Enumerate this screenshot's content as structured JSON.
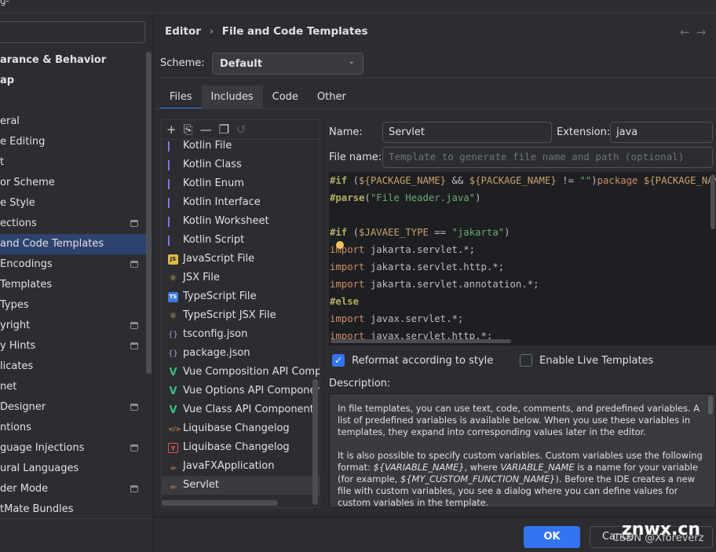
{
  "window": {
    "title_fragment": "g-"
  },
  "sidebar": {
    "items": [
      {
        "label": "arance & Behavior",
        "bold": true
      },
      {
        "label": "ap",
        "bold": true
      },
      {
        "label": ""
      },
      {
        "label": "eral"
      },
      {
        "label": "e Editing"
      },
      {
        "label": "t"
      },
      {
        "label": "or Scheme"
      },
      {
        "label": "e Style"
      },
      {
        "label": "ections",
        "icon": true
      },
      {
        "label": "and Code Templates",
        "selected": true
      },
      {
        "label": "Encodings",
        "icon": true
      },
      {
        "label": " Templates"
      },
      {
        "label": "Types"
      },
      {
        "label": "yright",
        "icon": true
      },
      {
        "label": "y Hints",
        "icon": true
      },
      {
        "label": "licates"
      },
      {
        "label": "net"
      },
      {
        "label": " Designer",
        "icon": true
      },
      {
        "label": "ntions"
      },
      {
        "label": "guage Injections",
        "icon": true
      },
      {
        "label": "ural Languages"
      },
      {
        "label": "der Mode",
        "icon": true
      },
      {
        "label": "tMate Bundles"
      }
    ]
  },
  "header": {
    "breadcrumb": [
      "Editor",
      "File and Code Templates"
    ],
    "separator": "›",
    "back": "←",
    "forward": "→"
  },
  "scheme": {
    "label": "Scheme:",
    "value": "Default"
  },
  "tabs": [
    {
      "label": "Files",
      "selected": true
    },
    {
      "label": "Includes"
    },
    {
      "label": "Code"
    },
    {
      "label": "Other"
    }
  ],
  "toolbar": {
    "add": "+",
    "add_child": "⎘",
    "remove": "—",
    "copy": "❐",
    "reset": "↺"
  },
  "templates": [
    {
      "label": "Kotlin File",
      "icon": "kotlin-icon"
    },
    {
      "label": "Kotlin Class",
      "icon": "kotlin-icon"
    },
    {
      "label": "Kotlin Enum",
      "icon": "kotlin-icon"
    },
    {
      "label": "Kotlin Interface",
      "icon": "kotlin-icon"
    },
    {
      "label": "Kotlin Worksheet",
      "icon": "kotlin-icon"
    },
    {
      "label": "Kotlin Script",
      "icon": "kotlin-icon"
    },
    {
      "label": "JavaScript File",
      "icon": "js-icon"
    },
    {
      "label": "JSX File",
      "icon": "react-icon"
    },
    {
      "label": "TypeScript File",
      "icon": "ts-icon"
    },
    {
      "label": "TypeScript JSX File",
      "icon": "react-icon"
    },
    {
      "label": "tsconfig.json",
      "icon": "json-icon"
    },
    {
      "label": "package.json",
      "icon": "json-icon"
    },
    {
      "label": "Vue Composition API Component",
      "icon": "vue-icon"
    },
    {
      "label": "Vue Options API Component",
      "icon": "vue-icon"
    },
    {
      "label": "Vue Class API Component",
      "icon": "vue-icon"
    },
    {
      "label": "Liquibase Changelog",
      "icon": "xml-icon"
    },
    {
      "label": "Liquibase Changelog",
      "icon": "yaml-icon"
    },
    {
      "label": "JavaFXApplication",
      "icon": "java-icon"
    },
    {
      "label": "Servlet",
      "icon": "java-icon",
      "selected": true
    }
  ],
  "form": {
    "name_label": "Name:",
    "name_value": "Servlet",
    "ext_label": "Extension:",
    "ext_value": "java",
    "filename_label": "File name:",
    "filename_placeholder": "Template to generate file name and path (optional)"
  },
  "code": [
    "#if (${PACKAGE_NAME} && ${PACKAGE_NAME} != \"\")package ${PACKAGE_NAME};#end",
    "#parse(\"File Header.java\")",
    "",
    "#if ($JAVAEE_TYPE == \"jakarta\")",
    "import jakarta.servlet.*;",
    "import jakarta.servlet.http.*;",
    "import jakarta.servlet.annotation.*;",
    "#else",
    "import javax.servlet.*;",
    "import javax.servlet.http.*;"
  ],
  "options": {
    "reformat": {
      "label": "Reformat according to style",
      "checked": true
    },
    "live": {
      "label": "Enable Live Templates",
      "checked": false
    }
  },
  "description": {
    "label": "Description:",
    "p1": "In file templates, you can use text, code, comments, and predefined variables. A list of predefined variables is available below. When you use these variables in templates, they expand into corresponding values later in the editor.",
    "p2a": "It is also possible to specify custom variables. Custom variables use the following format: ",
    "p2b": "${VARIABLE_NAME}",
    "p2c": ", where ",
    "p2d": "VARIABLE_NAME",
    "p2e": " is a name for your variable (for example, ",
    "p2f": "${MY_CUSTOM_FUNCTION_NAME}",
    "p2g": "). Before the IDE creates a new file with custom variables, you see a dialog where you can define values for custom variables in the template."
  },
  "buttons": {
    "ok": "OK",
    "cancel": "Cancel"
  },
  "watermark": {
    "site": "znwx.cn",
    "author": "CSDN @Xforeverz"
  },
  "colors": {
    "accent": "#3574f0",
    "selection": "#2e436e",
    "background": "#2b2d30",
    "editor": "#1e1f22"
  }
}
